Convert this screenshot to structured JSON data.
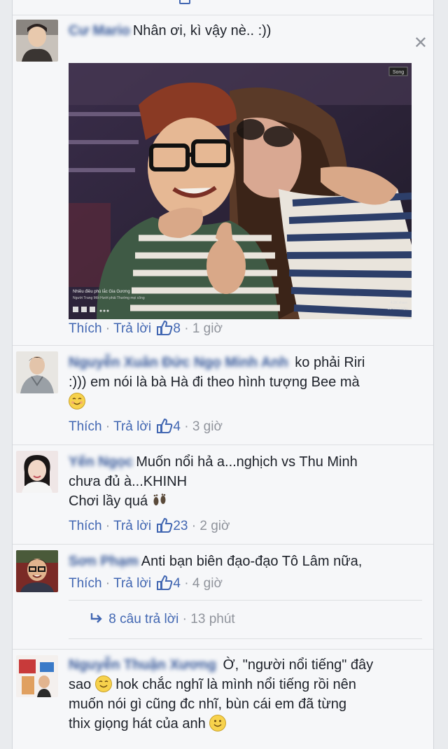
{
  "ui": {
    "like_label": "Thích",
    "reply_label": "Trả lời",
    "dot": " · ",
    "close_glyph": "✕"
  },
  "comments": [
    {
      "name": "Cư Mario",
      "text": "Nhân ơi, kì vậy nè.. :))",
      "likes": "8",
      "time": "1 giờ",
      "photo": {
        "badge": "Song",
        "caption_line1": "Nhiều điều phù lắc Gia Gương",
        "caption_line2": "Người Trang Mối Hướt phải Thường mọi công",
        "corner_line1": "4,3K share",
        "corner_line2": "2D bình luận"
      }
    },
    {
      "name": "Nguyễn Xuân Đức Ngọ Minh Anh",
      "text_line1": "ko phải Riri",
      "text_line2": ":))) em nói là bà Hà đi theo hình tượng Bee mà",
      "emoji": "smile-emoji",
      "likes": "4",
      "time": "3 giờ"
    },
    {
      "name": "Yến Ngọc",
      "text_line1": "Muốn nổi hả a...nghịch vs Thu Minh",
      "text_line2": "chưa đủ à...KHINH",
      "text_line3": "Chơi lầy quá",
      "emoji": "footprints-emoji",
      "likes": "23",
      "time": "2 giờ"
    },
    {
      "name": "Sơn Phạm",
      "text": "Anti bạn biên đạo-đạo Tô Lâm nữa,",
      "likes": "4",
      "time": "4 giờ",
      "replies": {
        "label": "8 câu trả lời",
        "time": "13 phút",
        "icon": "reply-arrow-icon"
      }
    },
    {
      "name": "Nguyễn Thuận Xương",
      "text_line1": "Ờ, \"người nổi tiếng\" đây",
      "text_line2a": "sao",
      "text_line2b": "hok chắc nghĩ là mình nổi tiếng rồi nên",
      "text_line3": "muốn nói gì cũng đc nhĩ, bùn cái em đã từng",
      "text_line4": "thix giọng hát của anh",
      "emoji": "smile-emoji"
    }
  ],
  "colors": {
    "link": "#4267b2",
    "name": "#365899",
    "meta": "#90949c",
    "background": "#f6f7f9"
  }
}
